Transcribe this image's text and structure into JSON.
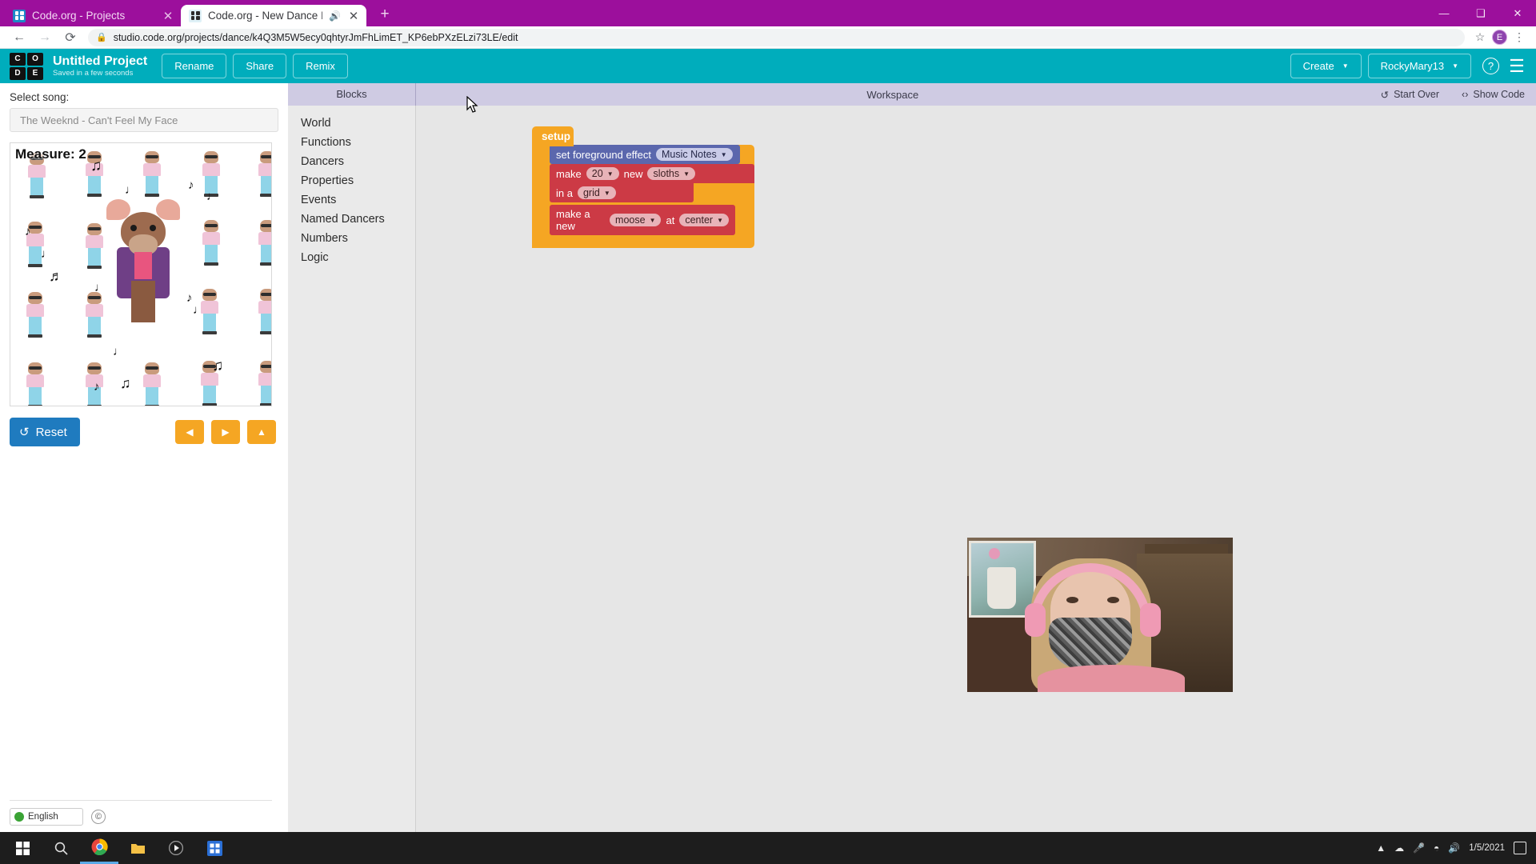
{
  "browser": {
    "tabs": [
      {
        "title": "Code.org - Projects",
        "active": false,
        "favicon": "codeorg-icon",
        "close": "✕"
      },
      {
        "title": "Code.org - New Dance Lab P",
        "active": true,
        "favicon": "codeorg-icon",
        "audio": "🔊",
        "close": "✕"
      }
    ],
    "newtab_label": "+",
    "window_controls": {
      "minimize": "—",
      "maximize": "❑",
      "close": "✕"
    },
    "nav": {
      "back": "←",
      "forward": "→",
      "reload": "⟳"
    },
    "url": "studio.code.org/projects/dance/k4Q3M5W5ecy0qhtyrJmFhLimET_KP6ebPXzELzi73LE/edit",
    "lock_icon": "🔒",
    "star_icon": "☆",
    "profile_initial": "E",
    "menu_icon": "⋮"
  },
  "header": {
    "logo": [
      "C",
      "O",
      "D",
      "E"
    ],
    "project_title": "Untitled Project",
    "saved_status": "Saved in a few seconds",
    "rename_label": "Rename",
    "share_label": "Share",
    "remix_label": "Remix",
    "create_label": "Create",
    "user_label": "RockyMary13",
    "caret": "▼",
    "help_icon": "?",
    "menu_icon": "☰",
    "accent_color": "#00adbc"
  },
  "left_panel": {
    "song_label": "Select song:",
    "song_value": "The Weeknd - Can't Feel My Face",
    "measure_label": "Measure:",
    "measure_value": "2",
    "reset_label": "Reset",
    "reset_icon": "↺",
    "controls": [
      {
        "name": "step-back-button",
        "glyph": "◀"
      },
      {
        "name": "play-button",
        "glyph": "▶"
      },
      {
        "name": "step-up-button",
        "glyph": "▲"
      }
    ],
    "language_value": "English",
    "copyright_glyph": "©"
  },
  "workspace": {
    "blocks_tab_label": "Blocks",
    "workspace_tab_label": "Workspace",
    "start_over_label": "Start Over",
    "start_over_icon": "↺",
    "show_code_label": "Show Code",
    "show_code_icon": "‹›",
    "palette": [
      "World",
      "Functions",
      "Dancers",
      "Properties",
      "Events",
      "Named Dancers",
      "Numbers",
      "Logic"
    ],
    "blocks": {
      "setup_label": "setup",
      "effect_text": "set foreground effect",
      "effect_value": "Music Notes",
      "make_text": "make",
      "make_count": "20",
      "new_text": "new",
      "make_type": "sloths",
      "in_a_text": "in a",
      "layout_value": "grid",
      "make_new_text": "make a new",
      "dancer_value": "moose",
      "at_text": "at",
      "position_value": "center",
      "caret": "▼"
    }
  },
  "taskbar": {
    "start_icon": "⊞",
    "apps": [
      "search-icon",
      "chrome-icon",
      "explorer-icon",
      "media-icon",
      "store-icon"
    ],
    "tray": [
      "caret-up-icon",
      "cloud-icon",
      "mic-icon",
      "wifi-icon",
      "volume-icon"
    ],
    "clock_time": "1/5/2021",
    "notification_icon": "▢"
  }
}
